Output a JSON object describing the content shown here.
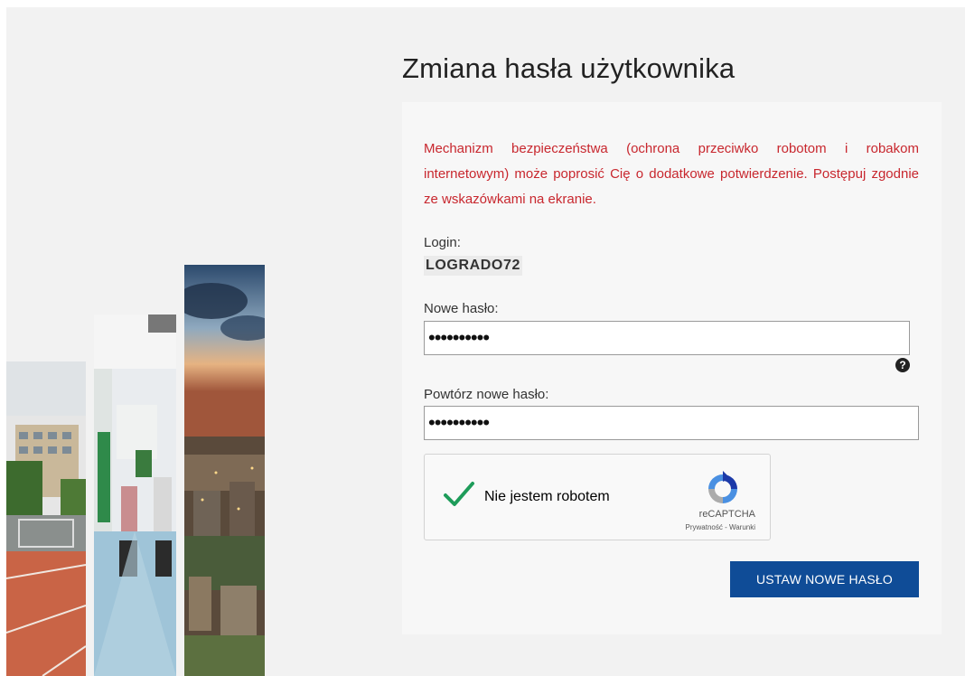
{
  "page": {
    "title": "Zmiana hasła użytkownika",
    "info_text": "Mechanizm bezpieczeństwa (ochrona przeciwko robotom i robakom internetowym) może poprosić Cię o dodatkowe potwierdzenie. Postępuj zgodnie ze wskazówkami na ekranie."
  },
  "login": {
    "label": "Login:",
    "value": "LOGRADO72"
  },
  "new_password": {
    "label": "Nowe hasło:",
    "masked_value": "••••••••••",
    "help_icon": "?"
  },
  "repeat_password": {
    "label": "Powtórz nowe hasło:",
    "masked_value": "••••••••••"
  },
  "captcha": {
    "label": "Nie jestem robotem",
    "brand": "reCAPTCHA",
    "links": "Prywatność - Warunki",
    "checked": true
  },
  "submit": {
    "label": "USTAW NOWE HASŁO"
  },
  "colors": {
    "accent": "#0f4c97",
    "warning": "#c8272e",
    "check": "#1e9c5a"
  }
}
